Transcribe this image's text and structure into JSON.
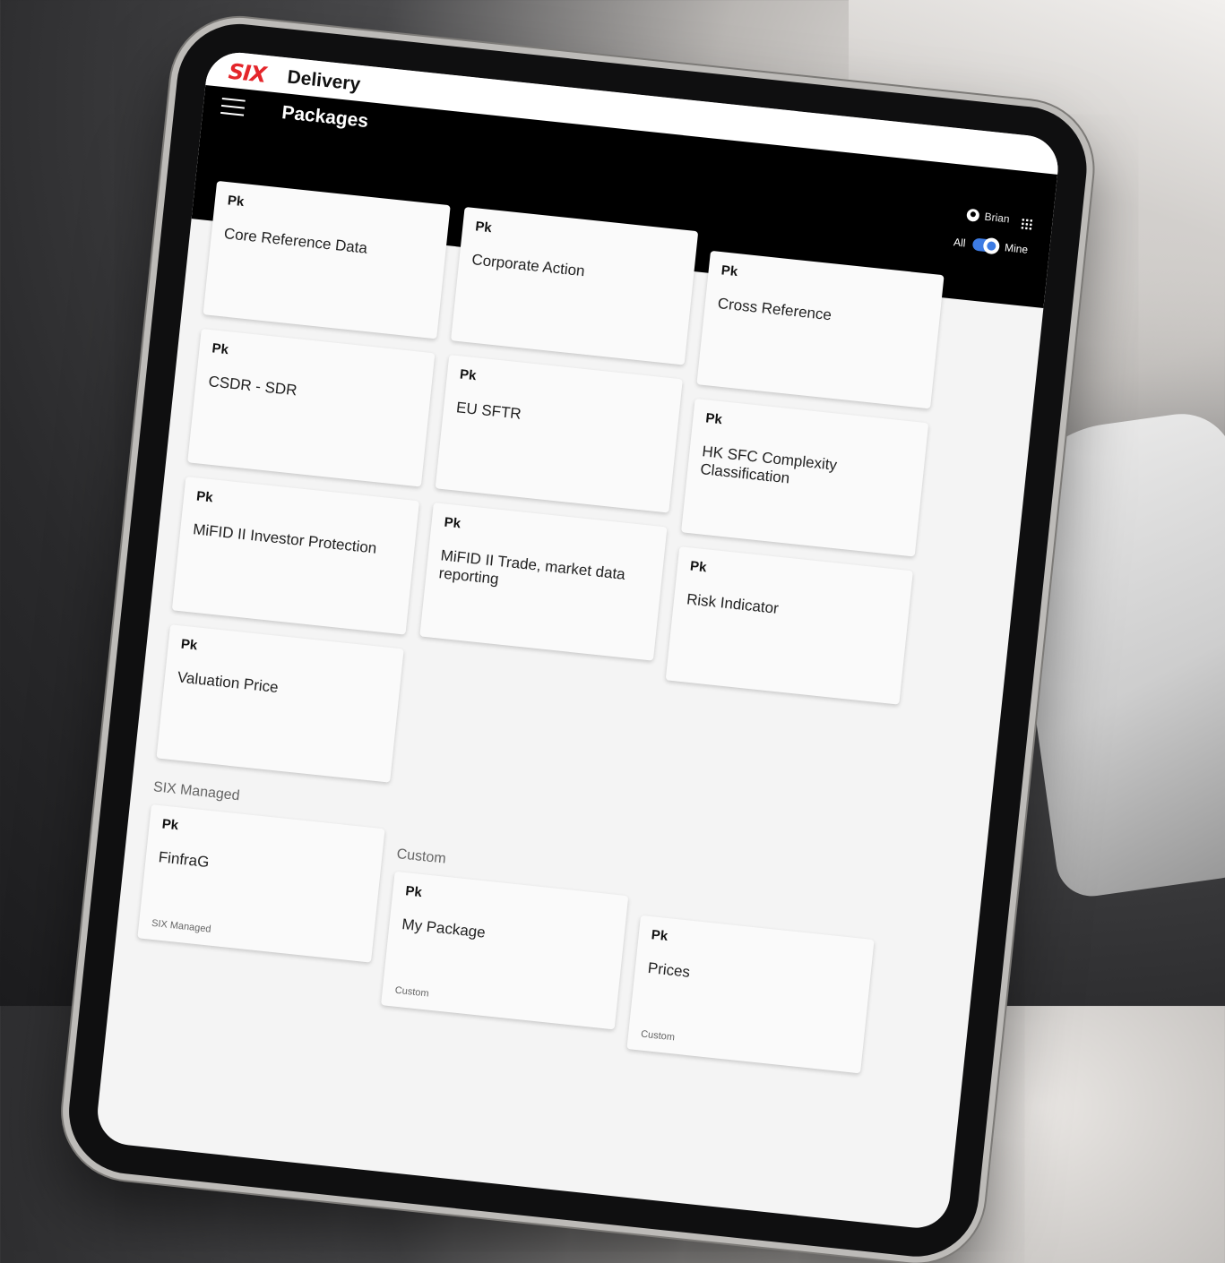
{
  "app": {
    "logo": "SIX",
    "title": "Delivery"
  },
  "toolbar": {
    "page_title": "Packages",
    "add_label": "+"
  },
  "user": {
    "name": "Brian"
  },
  "filter": {
    "all_label": "All",
    "mine_label": "Mine",
    "mine_enabled": true
  },
  "packages": [
    {
      "badge": "Pk",
      "name": "Core Reference Data"
    },
    {
      "badge": "Pk",
      "name": "Corporate Action"
    },
    {
      "badge": "Pk",
      "name": "Cross Reference"
    },
    {
      "badge": "Pk",
      "name": "CSDR - SDR"
    },
    {
      "badge": "Pk",
      "name": "EU SFTR"
    },
    {
      "badge": "Pk",
      "name": "HK SFC Complexity Classification"
    },
    {
      "badge": "Pk",
      "name": "MiFID II Investor Protection"
    },
    {
      "badge": "Pk",
      "name": "MiFID II Trade, market data reporting"
    },
    {
      "badge": "Pk",
      "name": "Risk Indicator"
    },
    {
      "badge": "Pk",
      "name": "Valuation Price"
    }
  ],
  "sections": [
    {
      "title": "SIX Managed",
      "packages": [
        {
          "badge": "Pk",
          "name": "FinfraG",
          "tag": "SIX Managed"
        }
      ]
    },
    {
      "title": "Custom",
      "packages": [
        {
          "badge": "Pk",
          "name": "My Package",
          "tag": "Custom"
        },
        {
          "badge": "Pk",
          "name": "Prices",
          "tag": "Custom"
        }
      ]
    }
  ]
}
